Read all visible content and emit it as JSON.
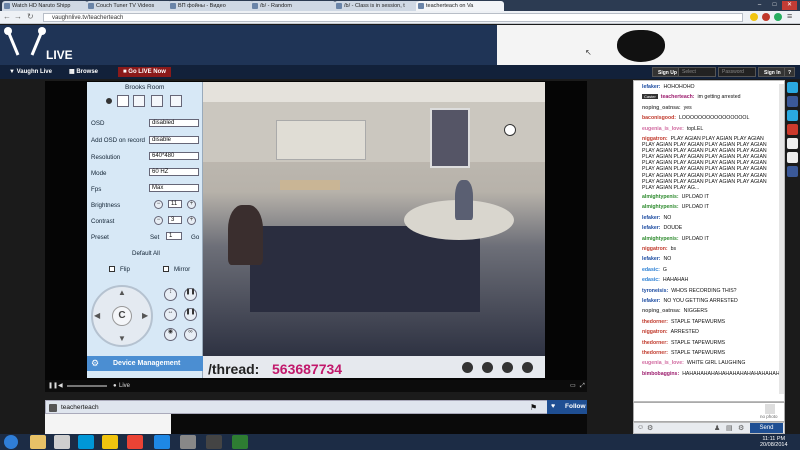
{
  "browser": {
    "tabs": [
      {
        "label": "Watch HD Naruto Shipp"
      },
      {
        "label": "Couch Tuner TV Videos"
      },
      {
        "label": "ВП фойны - Видео"
      },
      {
        "label": "/b/ - Random"
      },
      {
        "label": "/b/ - Class is in session, t"
      },
      {
        "label": "teacherteach on Va"
      }
    ],
    "url": "vaughnlive.tv/teacherteach"
  },
  "header": {
    "logo": "LIVE",
    "nav": {
      "vaughn": "Vaughn Live",
      "browse": "Browse",
      "golive": "Go LIVE Now"
    },
    "signup": "Sign Up",
    "select_placeholder": "Select",
    "password_placeholder": "Password",
    "signin": "Sign In"
  },
  "camera_panel": {
    "title": "Brooks Room",
    "osd": {
      "label": "OSD",
      "value": "disabled"
    },
    "osd_record": {
      "label": "Add OSD on record",
      "value": "disable"
    },
    "resolution": {
      "label": "Resolution",
      "value": "640*480"
    },
    "mode": {
      "label": "Mode",
      "value": "60 HZ"
    },
    "fps": {
      "label": "Fps",
      "value": "Max"
    },
    "brightness": {
      "label": "Brightness",
      "value": "11"
    },
    "contrast": {
      "label": "Contrast",
      "value": "3"
    },
    "preset": {
      "label": "Preset",
      "set": "Set",
      "value": "1",
      "go": "Go"
    },
    "default_all": "Default All",
    "flip": "Flip",
    "mirror": "Mirror",
    "center": "C",
    "device_management": "Device Management"
  },
  "overlay": {
    "thread_label": "/thread:",
    "thread_number": "563687734"
  },
  "player": {
    "live_label": "Live"
  },
  "channel": {
    "name": "teacherteach",
    "follow": "Follow"
  },
  "chat": {
    "messages": [
      {
        "user": "lefaker:",
        "text": "HOHOHOHO",
        "color": "#1a4aa0"
      },
      {
        "user": "teacherteach:",
        "text": "im getting arrested",
        "color": "#9b1a6c",
        "badge": "Caster"
      },
      {
        "user": "noping_oatnsa:",
        "text": "yes",
        "color": "#555555"
      },
      {
        "user": "baconisgood:",
        "text": "LOOOOOOOOOOOOOOOOL",
        "color": "#c0392b"
      },
      {
        "user": "eugenia_is_love:",
        "text": "topLEL",
        "color": "#d16aa0"
      },
      {
        "user": "niggatron:",
        "text": "PLAY AGIAN PLAY AGIAN PLAY AGIAN PLAY AGIAN PLAY AGIAN PLAY AGIAN PLAY AGIAN PLAY AGIAN PLAY AGIAN PLAY AGIAN PLAY AGIAN PLAY AGIAN PLAY AGIAN PLAY AGIAN PLAY AGIAN PLAY AGIAN PLAY AGIAN PLAY AGIAN PLAY AGIAN PLAY AGIAN PLAY AGIAN PLAY AGIAN PLAY AGIAN PLAY AGIAN PLAY AGIAN PLAY AGIAN PLAY AGIAN PLAY AGIAN PLAY AGIAN PLAY AGIAN PLAY AGIAN PLAY AGIAN PLAY AG...",
        "color": "#c0392b"
      },
      {
        "user": "almightypenis:",
        "text": "UPLOAD IT",
        "color": "#2e8b2e"
      },
      {
        "user": "almightypenis:",
        "text": "UPLOAD IT",
        "color": "#2e8b2e"
      },
      {
        "user": "lefaker:",
        "text": "NO",
        "color": "#1a4aa0"
      },
      {
        "user": "lefaker:",
        "text": "DOUDE",
        "color": "#1a4aa0"
      },
      {
        "user": "almightypenis:",
        "text": "UPLOAD IT",
        "color": "#2e8b2e"
      },
      {
        "user": "niggatron:",
        "text": "bs",
        "color": "#c0392b"
      },
      {
        "user": "lefaker:",
        "text": "NO",
        "color": "#1a4aa0"
      },
      {
        "user": "edasic:",
        "text": "G",
        "color": "#2a7fd4"
      },
      {
        "user": "edasic:",
        "text": "HAHAHAH",
        "color": "#2a7fd4"
      },
      {
        "user": "tyroneisis:",
        "text": "WHOS RECORDING THIS?",
        "color": "#1a4aa0"
      },
      {
        "user": "lefaker:",
        "text": "NO YOU GETTING ARRESTED",
        "color": "#1a4aa0"
      },
      {
        "user": "noping_oatnsa:",
        "text": "NIGGERS",
        "color": "#555555"
      },
      {
        "user": "thedorner:",
        "text": "STAPLE TAPEWURMS",
        "color": "#c0392b"
      },
      {
        "user": "niggatron:",
        "text": "ARRESTED",
        "color": "#c0392b"
      },
      {
        "user": "thedorner:",
        "text": "STAPLE TAPEWURMS",
        "color": "#c0392b"
      },
      {
        "user": "thedorner:",
        "text": "STAPLE TAPEWURMS",
        "color": "#c0392b"
      },
      {
        "user": "eugenia_is_love:",
        "text": "WHITE GIRL LAUGHING",
        "color": "#d16aa0"
      },
      {
        "user": "bimbobaggins:",
        "text": "HAHAHAHAHAHAHAHAHAHAHAHAHAHAHAHAHAHA GOLD",
        "color": "#9b1a6c"
      }
    ],
    "no_photo": "no photo",
    "send": "Send"
  },
  "taskbar": {
    "time": "11:11 PM",
    "date": "20/08/2014"
  }
}
